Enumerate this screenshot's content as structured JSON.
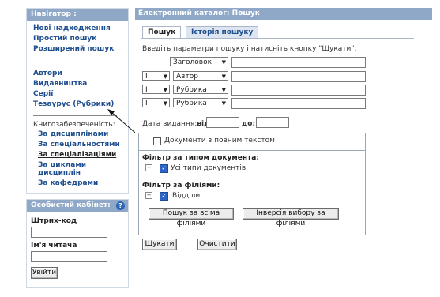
{
  "navigator": {
    "title": "Навігатор :",
    "links": [
      "Нові надходження",
      "Простий пошук",
      "Розширений пошук"
    ],
    "links2": [
      "Автори",
      "Видавництва",
      "Серії",
      "Тезаурус (Рубрики)"
    ],
    "support_label": "Книгозабезпеченість:",
    "support_links": [
      "За дисциплінами",
      "За спеціальностями",
      "За спеціалізаціями",
      "За циклами дисциплін",
      "За кафедрами"
    ]
  },
  "cabinet": {
    "title": "Особистий кабінет:",
    "help_icon": "?",
    "barcode_label": "Штрих-код",
    "barcode_value": "",
    "reader_label": "Ім'я читача",
    "reader_value": "",
    "login_button": "Увійти"
  },
  "main": {
    "title": "Електронний каталог: Пошук",
    "tabs": [
      "Пошук",
      "Історія пошуку"
    ],
    "instruction": "Введіть параметри пошуку і натисніть кнопку \"Шукати\".",
    "rows": [
      {
        "op": "",
        "field": "Заголовок",
        "value": ""
      },
      {
        "op": "І",
        "field": "Автор",
        "value": ""
      },
      {
        "op": "І",
        "field": "Рубрика",
        "value": ""
      },
      {
        "op": "І",
        "field": "Рубрика",
        "value": ""
      }
    ],
    "date_label": "Дата видання:",
    "from_label": "від:",
    "to_label": "до:",
    "from_value": "",
    "to_value": "",
    "fulltext_label": "Документи з повним текстом",
    "doctype_heading": "Фільтр за типом документа:",
    "doctype_item": "Усі типи документів",
    "branch_heading": "Фільтр за філіями:",
    "branch_item": "Відділи",
    "search_all_button": "Пошук за всіма філіями",
    "invert_button": "Інверсія вибору за філіями",
    "search_button": "Шукати",
    "clear_button": "Очистити"
  }
}
